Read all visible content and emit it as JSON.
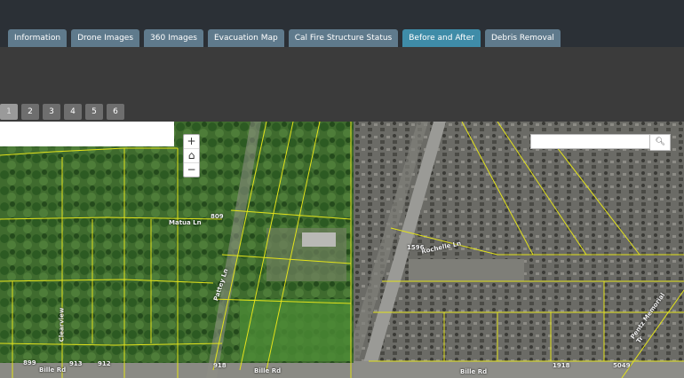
{
  "tabs": [
    {
      "label": "Information",
      "active": false
    },
    {
      "label": "Drone Images",
      "active": false
    },
    {
      "label": "360 Images",
      "active": false
    },
    {
      "label": "Evacuation Map",
      "active": false
    },
    {
      "label": "Cal Fire Structure Status",
      "active": false
    },
    {
      "label": "Before and After",
      "active": true
    },
    {
      "label": "Debris Removal",
      "active": false
    }
  ],
  "pages": [
    "1",
    "2",
    "3",
    "4",
    "5",
    "6"
  ],
  "selected_page": "1",
  "map": {
    "zoom_in": "+",
    "home": "⌂",
    "zoom_out": "−",
    "search_placeholder": "",
    "search_icon": "search-icon",
    "labels": {
      "matua": "Matua Ln",
      "patty": "Pattey Ln",
      "clearview": "Clearview",
      "rochelle": "Rochelle Ln",
      "bille_left": "Bille Rd",
      "bille_mid": "Bille Rd",
      "bille_right": "Bille Rd",
      "pentz": "Pentz Memorial Tr",
      "n899": "899",
      "n913": "913",
      "n912": "912",
      "n918": "918",
      "n5049": "5049",
      "n1918": "1918",
      "n1596": "1596",
      "n809": "809"
    }
  }
}
